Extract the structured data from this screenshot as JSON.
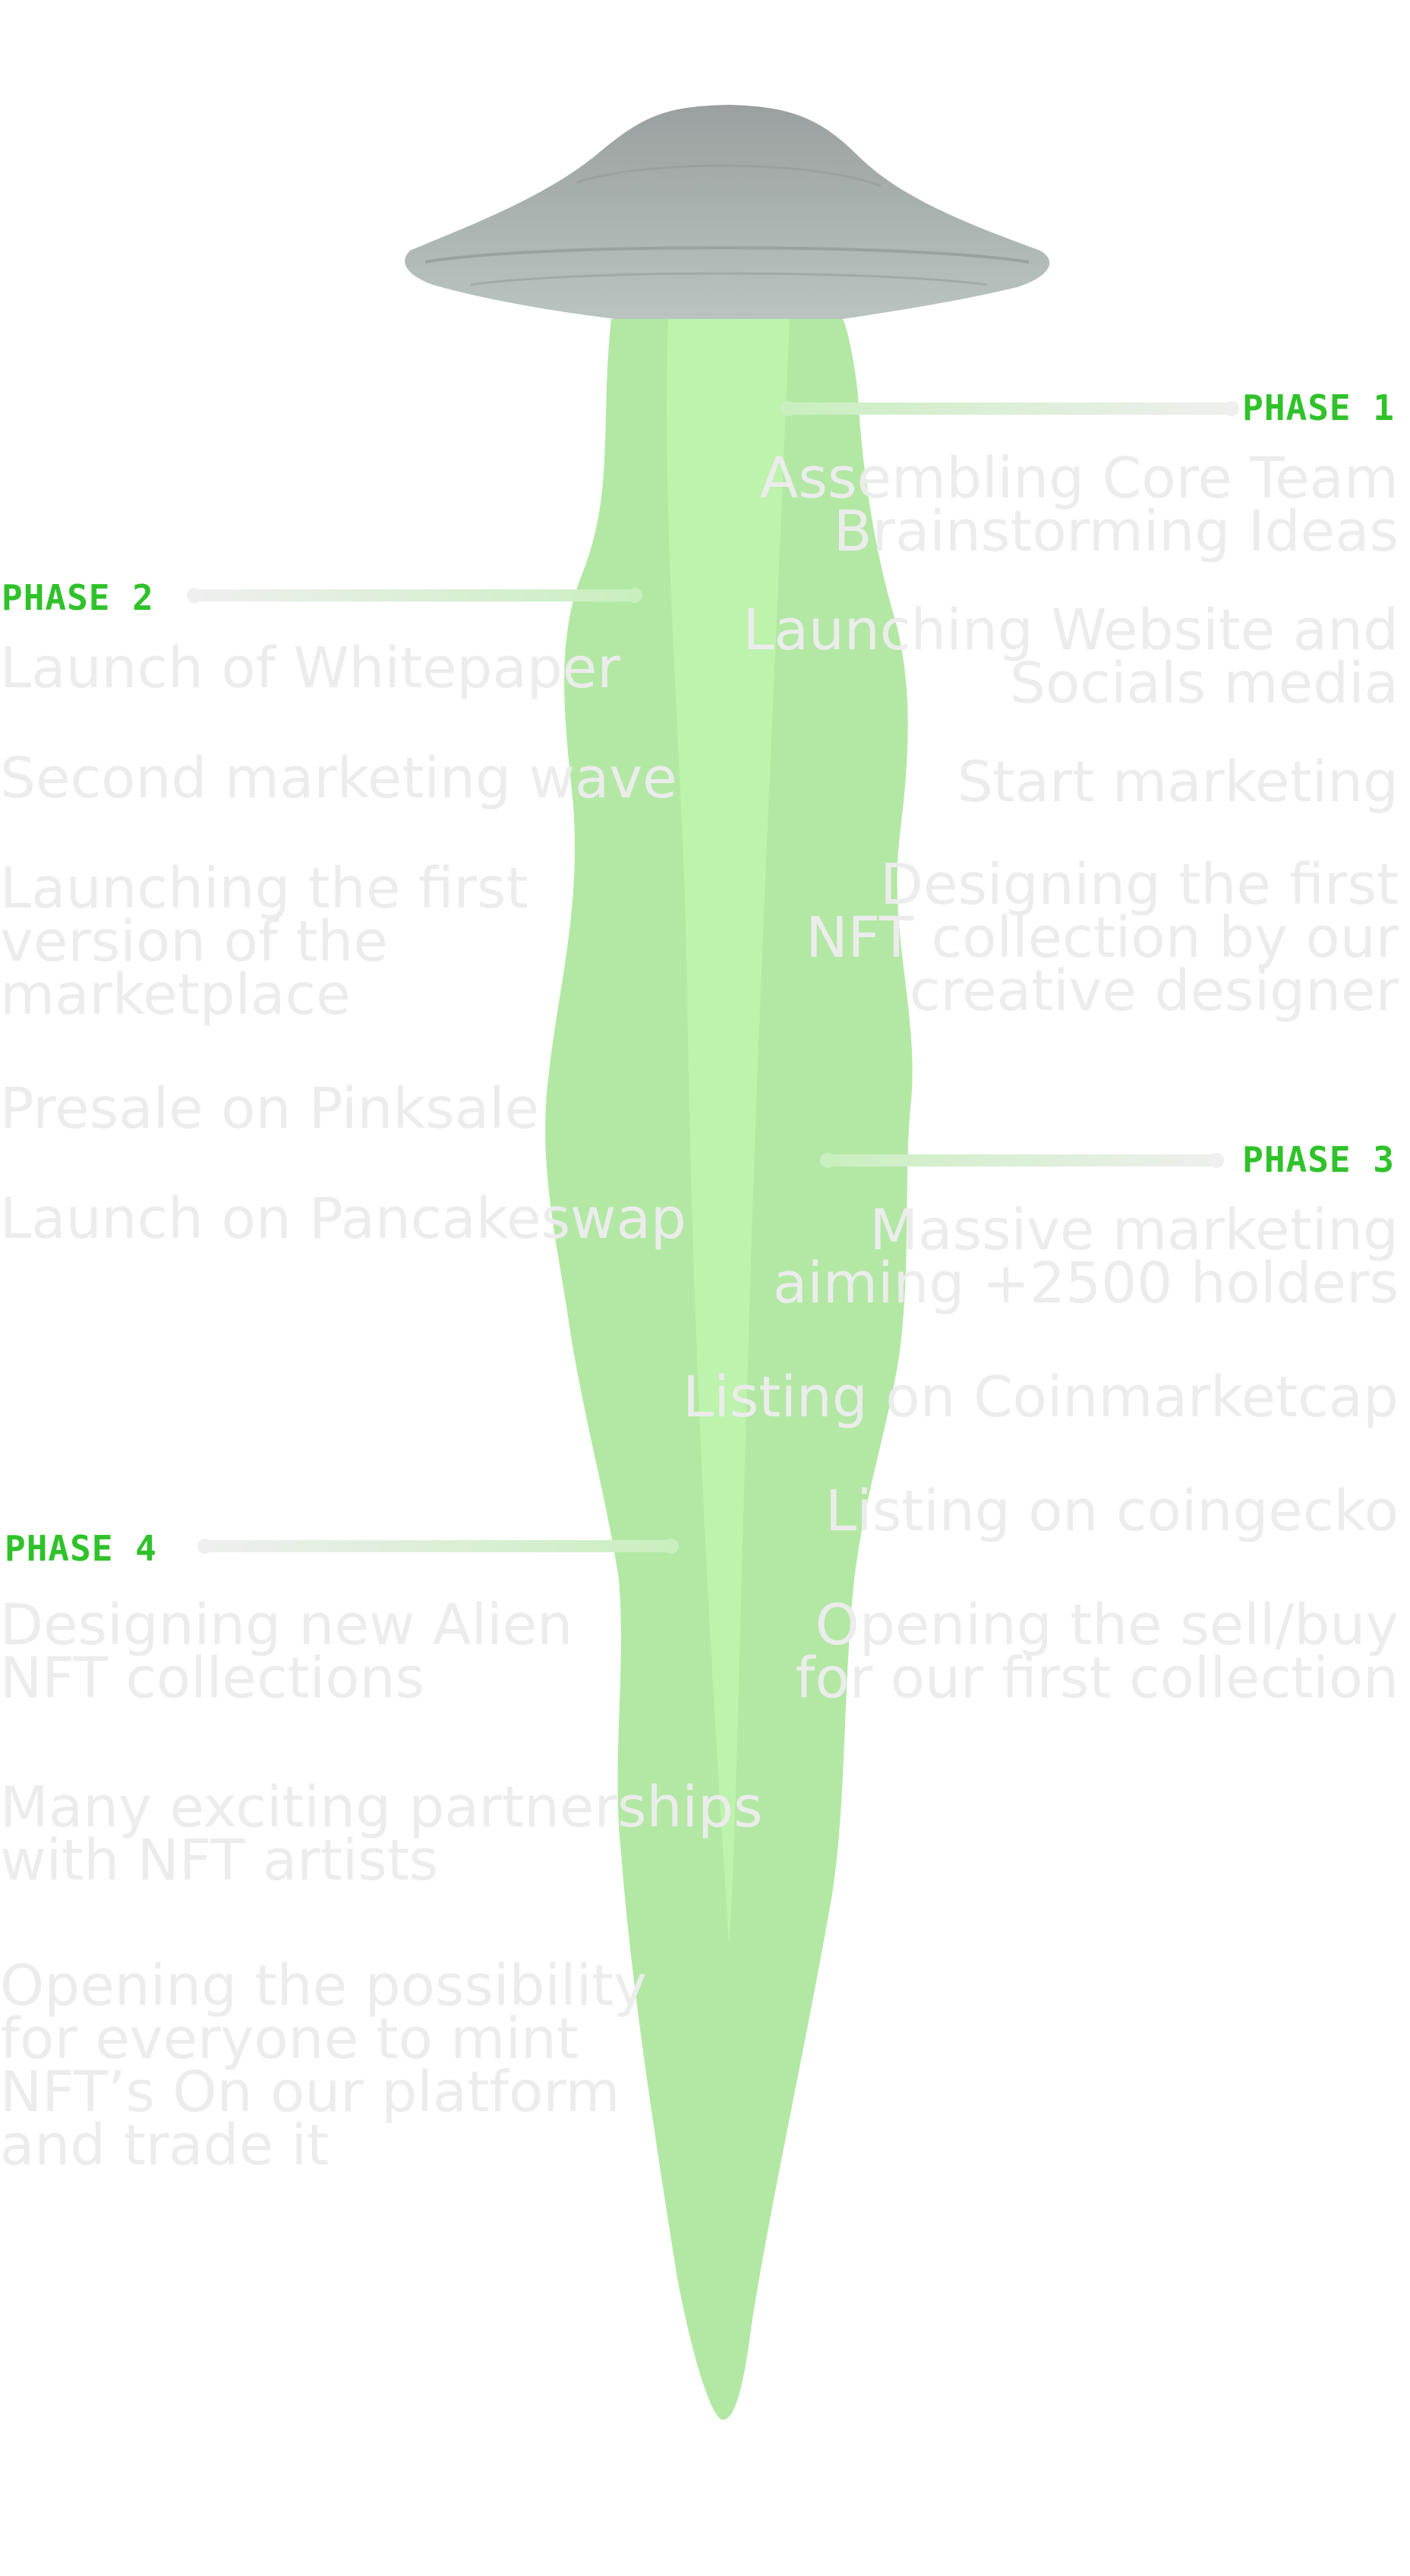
{
  "colors": {
    "phase_label": "#2fc22a",
    "item_text": "#ececec",
    "beam_green": "#aee89e",
    "ufo_gray": "#a7aeac",
    "connector": "#ececec"
  },
  "phases": [
    {
      "label": "PHASE 1",
      "items": [
        "Assembling Core Team\nBrainstorming Ideas",
        "Launching Website and\nSocials media",
        "Start marketing",
        "Designing the first\nNFT collection by our\ncreative designer"
      ]
    },
    {
      "label": "PHASE 2",
      "items": [
        "Launch of Whitepaper",
        "Second marketing wave",
        "Launching the first\nversion of the\nmarketplace",
        "Presale on Pinksale",
        "Launch on Pancakeswap"
      ]
    },
    {
      "label": "PHASE 3",
      "items": [
        "Massive marketing\naiming +2500 holders",
        "Listing on Coinmarketcap",
        "Listing on coingecko",
        "Opening the sell/buy\nfor our first collection"
      ]
    },
    {
      "label": "PHASE 4",
      "items": [
        "Designing new Alien\nNFT collections",
        "Many exciting partnerships\nwith NFT artists",
        "Opening the possibility\nfor everyone to mint\nNFT’s On our platform\nand trade it"
      ]
    }
  ]
}
